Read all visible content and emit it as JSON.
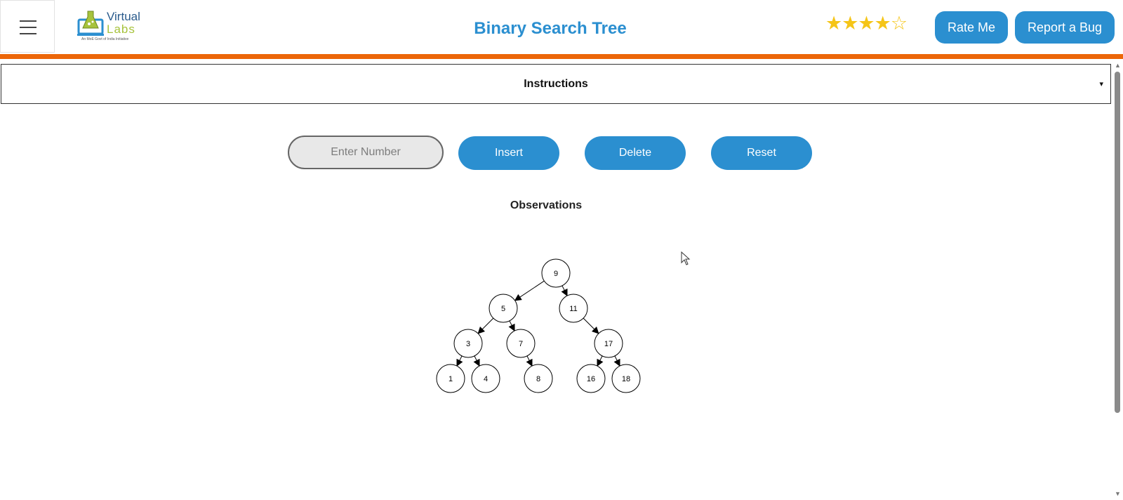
{
  "header": {
    "menu_icon": "hamburger-icon",
    "logo_text_1": "Virtual",
    "logo_text_2": "Labs",
    "logo_tagline": "An MoE Govt of India Initiative",
    "title": "Binary Search Tree",
    "rating": {
      "value": 4,
      "max": 5,
      "filled": "★★★★",
      "empty": "☆"
    },
    "rate_label": "Rate Me",
    "bug_label": "Report a Bug",
    "accent_color": "#2b8fd0",
    "bar_color": "#ec6608"
  },
  "instructions": {
    "label": "Instructions",
    "caret": "▾"
  },
  "controls": {
    "input_placeholder": "Enter Number",
    "input_value": "",
    "insert_label": "Insert",
    "delete_label": "Delete",
    "reset_label": "Reset"
  },
  "observations": {
    "label": "Observations"
  },
  "tree": {
    "nodes": [
      "9",
      "5",
      "11",
      "3",
      "7",
      "17",
      "1",
      "4",
      "8",
      "16",
      "18"
    ],
    "edges": [
      [
        "9",
        "5"
      ],
      [
        "9",
        "11"
      ],
      [
        "5",
        "3"
      ],
      [
        "5",
        "7"
      ],
      [
        "11",
        "17"
      ],
      [
        "3",
        "1"
      ],
      [
        "3",
        "4"
      ],
      [
        "7",
        "8"
      ],
      [
        "17",
        "16"
      ],
      [
        "17",
        "18"
      ]
    ]
  }
}
